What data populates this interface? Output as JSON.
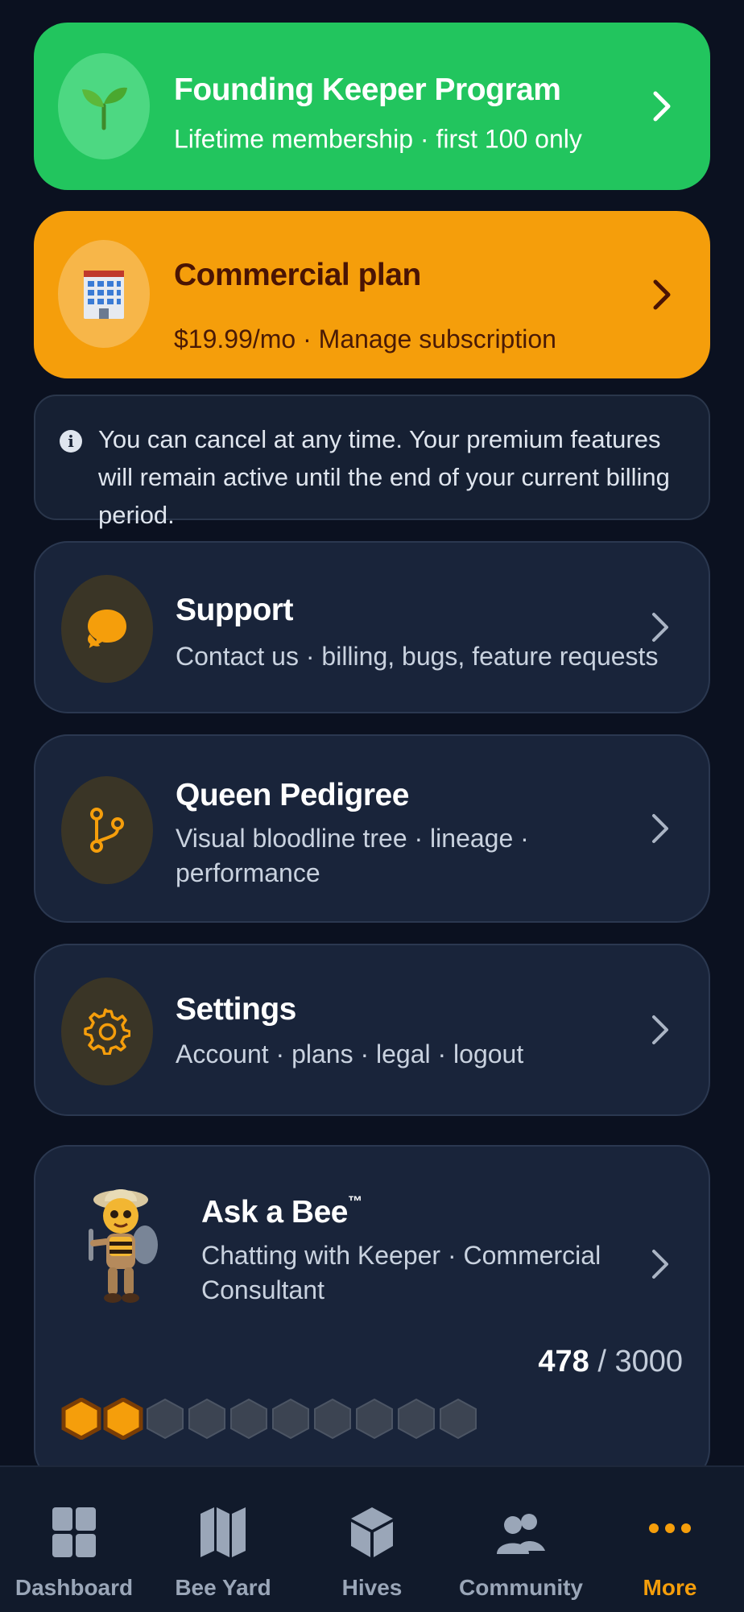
{
  "promos": {
    "founding": {
      "title": "Founding Keeper Program",
      "subtitle": "Lifetime membership · first 100 only",
      "icon": "seedling-icon",
      "color": "#22c55e"
    },
    "commercial": {
      "title": "Commercial plan",
      "subtitle": "$19.99/mo · Manage subscription",
      "icon": "office-building-icon",
      "color": "#f59e0b"
    }
  },
  "notice": {
    "text": "You can cancel at any time. Your premium features will remain active until the end of your current billing period."
  },
  "menu": {
    "support": {
      "title": "Support",
      "subtitle": "Contact us · billing, bugs, feature requests",
      "icon": "chat-bubbles-icon"
    },
    "pedigree": {
      "title": "Queen Pedigree",
      "subtitle": "Visual bloodline tree · lineage · performance",
      "icon": "branch-icon"
    },
    "settings": {
      "title": "Settings",
      "subtitle": "Account · plans · legal · logout",
      "icon": "gear-icon"
    }
  },
  "ask_bee": {
    "title": "Ask a Bee",
    "trademark": "™",
    "subtitle": "Chatting with Keeper · Commercial Consultant",
    "used": "478",
    "separator": "/",
    "limit": "3000",
    "hexes_filled": 2,
    "hexes_total": 10,
    "accent": "#f59e0b"
  },
  "bottom_nav": {
    "items": [
      {
        "label": "Dashboard",
        "icon": "grid-icon"
      },
      {
        "label": "Bee Yard",
        "icon": "map-icon"
      },
      {
        "label": "Hives",
        "icon": "cube-icon"
      },
      {
        "label": "Community",
        "icon": "users-icon"
      },
      {
        "label": "More",
        "icon": "dots-icon"
      }
    ],
    "active_index": 4,
    "active_color": "#f59e0b"
  }
}
